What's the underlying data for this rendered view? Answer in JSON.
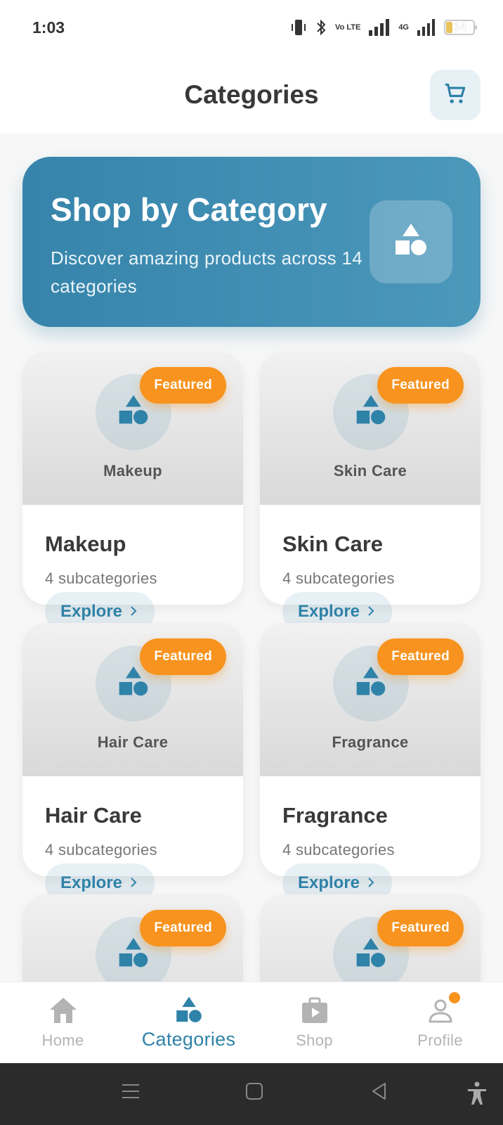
{
  "status_bar": {
    "time": "1:03",
    "volte_label": "Vo LTE",
    "network_label": "4G",
    "battery_level": "14"
  },
  "header": {
    "title": "Categories",
    "cart_icon": "cart-icon"
  },
  "hero": {
    "title": "Shop by Category",
    "subtitle": "Discover amazing products across 14 categories",
    "icon": "shapes-icon"
  },
  "categories": [
    {
      "image_label": "Makeup",
      "name": "Makeup",
      "subcategories": "4 subcategories",
      "badge": "Featured",
      "explore": "Explore"
    },
    {
      "image_label": "Skin Care",
      "name": "Skin Care",
      "subcategories": "4 subcategories",
      "badge": "Featured",
      "explore": "Explore"
    },
    {
      "image_label": "Hair Care",
      "name": "Hair Care",
      "subcategories": "4 subcategories",
      "badge": "Featured",
      "explore": "Explore"
    },
    {
      "image_label": "Fragrance",
      "name": "Fragrance",
      "subcategories": "4 subcategories",
      "badge": "Featured",
      "explore": "Explore"
    },
    {
      "image_label": "",
      "name": "",
      "subcategories": "",
      "badge": "Featured",
      "explore": ""
    },
    {
      "image_label": "",
      "name": "",
      "subcategories": "",
      "badge": "Featured",
      "explore": ""
    }
  ],
  "bottom_nav": {
    "items": [
      {
        "label": "Home",
        "icon": "home-icon",
        "active": false
      },
      {
        "label": "Categories",
        "icon": "shapes-icon",
        "active": true
      },
      {
        "label": "Shop",
        "icon": "shop-bag-icon",
        "active": false
      },
      {
        "label": "Profile",
        "icon": "profile-icon",
        "active": false
      }
    ]
  },
  "colors": {
    "accent": "#2f82a8",
    "hero_start": "#3684ab",
    "hero_end": "#4b98bb",
    "badge": "#f7931e",
    "inactive": "#b3b3b3"
  }
}
